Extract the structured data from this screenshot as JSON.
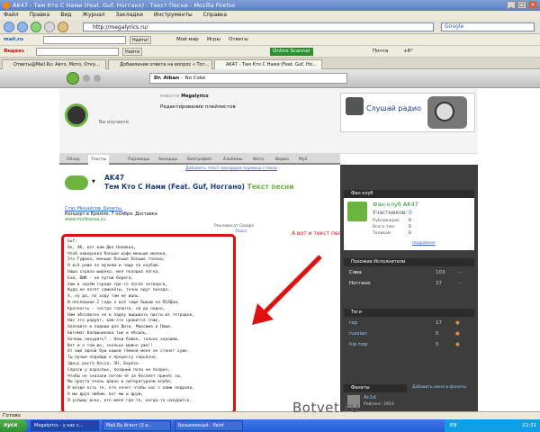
{
  "window": {
    "title": "AK47 - Тем Кто С Нами (Feat. Guf, Ноггано) - Текст Песни - Mozilla Firefox"
  },
  "menu": [
    "Файл",
    "Правка",
    "Вид",
    "Журнал",
    "Закладки",
    "Инструменты",
    "Справка"
  ],
  "nav": {
    "url": "http://megalyrics.ru/",
    "search_engine": "Google"
  },
  "toolbar1": {
    "brand": "mail.ru",
    "find": "Найти!",
    "myworld": "Мой мир",
    "games": "Игры",
    "answers": "Ответы"
  },
  "toolbar2": {
    "brand": "Яндекс",
    "find": "Найти",
    "bar_item": "Online Scanner",
    "mail": "Почта",
    "weather": "+6°"
  },
  "tabs": [
    {
      "label": "Ответы@Mail.Ru: Авто, Мото, Отку..."
    },
    {
      "label": "Добавление ответа на вопрос « Тот..."
    },
    {
      "label": "AK47 - Тем Кто С Нами (Feat. Guf, Но..."
    }
  ],
  "player": {
    "track": "Dr. Alban",
    "song": "No Coke"
  },
  "header": {
    "news_label": "новости",
    "news_site": "Megalyrics",
    "news_text": "Редактирование плейлистов",
    "radio_label": "Слушай радио",
    "logo_caption": "Вы изучаете"
  },
  "site_tabs": [
    "Обзор",
    "Тексты",
    "Переводы",
    "Аккорды",
    "Биография",
    "Альбомы",
    "Фото",
    "Видео",
    "Му2"
  ],
  "song": {
    "artist": "AK47",
    "title": "Тем Кто С Нами (Feat. Guf, Ноггано)",
    "title_suffix": "Текст песни",
    "add_link": "Добавить текст аккордов перевод стихов"
  },
  "ad": {
    "link": "Стас Михайлов. Билеты.",
    "line": "Концерт в Кремле. 7 ноября. Доставка",
    "url": "www.molikassa.ru",
    "label": "Реклама от Google",
    "extra": "Razor"
  },
  "annotation": "А вот и текст песни",
  "lyrics": [
    "Guf:",
    "Ак, АК, вот вам Два Наливка,",
    "Чтоб наверняка больше кофе меньше молока,",
    "Это Гуфака, меньше больше больше голока,",
    "Я всё реже по музеям и чаще по клубам.",
    "Наша страна широка, моя походка легка,",
    "Ехй, ВИК - не путай берега,",
    "Хам в своём городе где-то после четверга,",
    "Куда не летят самолёты, точно едут поезда.",
    "А, ну да, по ходу там не жаль.",
    "И последние 2 года я всё чаще бываю на ПЕАДом,",
    "Краткость - сестра таланта, ой да ладно,",
    "Нам абсолютно не в падлу вырывать листы из тетрадок,",
    "Нас это радует, вам это нравится тоже,",
    "Хлопайте в ладоши для Вити, Максима и Паши.",
    "Автомат Калашникова тык и обсыпь,",
    "Хочешь накурить? - Нахи божек, только хорошею.",
    "Вот и о том же, сколько можно уже!!",
    "От ещё одной буш вашей тёмной меня не станет хуже.",
    "Ты лучше подойди к процессу серьёзно,",
    "Здесь раста босса, ЗН, Берёза.",
    "Спроси у взрослых, поздний поза не поздно,",
    "Чтобы не сказали потом чё за бесплет принёс ты,",
    "Мы просто очень давно в литературном клубе,",
    "И везде есть те, кто хочет чтобы нас с нами подрали,",
    "А мы друз любим, вот мы и друж,",
    "Я услышу всех, кто меня где-то, когда-то накурится,"
  ],
  "sidebar": {
    "fan_club_header": "Фан клуб",
    "fan_club_title": "Фан клуб AK47",
    "members_label": "Участников:",
    "members_value": "0",
    "published_label": "Публикаций:",
    "published_value": "0",
    "total_label": "Всего тем:",
    "total_value": "0",
    "topics_label": "Топиков:",
    "topics_value": "0",
    "subscribe": "подробнее",
    "similar_header": "Похожие Исполнители",
    "similar": [
      {
        "name": "Сява",
        "score": "103"
      },
      {
        "name": "Ноггано",
        "score": "37"
      }
    ],
    "tags_header": "Теги",
    "tags": [
      {
        "name": "rap",
        "score": "17"
      },
      {
        "name": "russian",
        "score": "5"
      },
      {
        "name": "hip hop",
        "score": "5"
      }
    ],
    "fans_header": "Фанаты",
    "fans_link": "Добавить меня в фанаты",
    "fan_name": "Ac1d",
    "fan_rating": "Рейтинг: 2913"
  },
  "status": {
    "text": "Готово"
  },
  "taskbar": {
    "start": "пуск",
    "items": [
      "Megalyrics - у нас с...",
      "Mail.Ru Агент (3 в...",
      "Безымянный - Paint"
    ],
    "lang": "EN",
    "time": "22:31"
  },
  "watermark": "Botvet.ru",
  "colors": {
    "accent_green": "#6db33f",
    "annotation_red": "#e01010",
    "sidebar_dark": "#3d3d3d",
    "title_blue": "#1f3c80"
  }
}
